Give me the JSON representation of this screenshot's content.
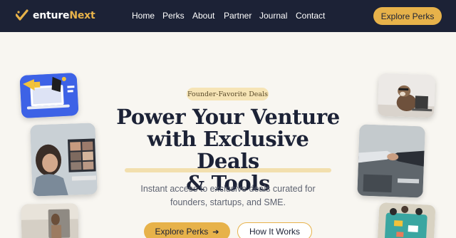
{
  "header": {
    "logo_text": "entureNext",
    "logo_text_plain": "enture",
    "logo_text_accent": "Next",
    "nav": [
      "Home",
      "Perks",
      "About",
      "Partner",
      "Journal",
      "Contact"
    ],
    "cta_label": "Explore Perks"
  },
  "hero": {
    "badge": "Founder-Favorite Deals",
    "headline_line1": "Power Your Venture",
    "headline_line2": "with Exclusive Deals",
    "headline_line3": "& Tools",
    "subtitle_line1": "Instant access to exclusive deals curated for",
    "subtitle_line2": "founders, startups, and SME.",
    "primary_button": "Explore Perks",
    "primary_button_icon": "arrow-right-icon",
    "secondary_button": "How It Works"
  },
  "colors": {
    "nav_bg": "#1c2236",
    "accent": "#e7b24a",
    "badge_bg": "#f6e4b6",
    "page_bg": "#f8f6f1",
    "heading": "#1c2236",
    "body_text": "#5e6371"
  },
  "images": [
    "megaphone-laptop-illustration",
    "video-call-photo",
    "desk-photo",
    "dog-laptop-photo",
    "handshake-photo",
    "team-table-photo"
  ]
}
